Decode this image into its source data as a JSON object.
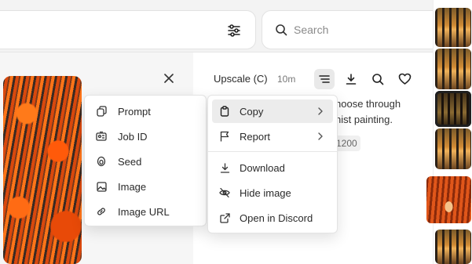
{
  "search": {
    "placeholder": "Search",
    "value": ""
  },
  "detail": {
    "title": "Upscale (C)",
    "time": "10m",
    "prompt_fragment_1": "hoose through",
    "prompt_fragment_2": "nist painting.",
    "param_fragment": "1200"
  },
  "context_menu": {
    "items": [
      {
        "label": "Copy",
        "icon": "clipboard-icon",
        "submenu": true
      },
      {
        "label": "Report",
        "icon": "flag-icon",
        "submenu": true
      },
      {
        "label": "Download",
        "icon": "download-icon"
      },
      {
        "label": "Hide image",
        "icon": "eye-off-icon"
      },
      {
        "label": "Open in Discord",
        "icon": "external-link-icon"
      }
    ]
  },
  "copy_submenu": {
    "items": [
      {
        "label": "Prompt",
        "icon": "copy-icon"
      },
      {
        "label": "Job ID",
        "icon": "id-card-icon"
      },
      {
        "label": "Seed",
        "icon": "seed-icon"
      },
      {
        "label": "Image",
        "icon": "image-icon"
      },
      {
        "label": "Image URL",
        "icon": "link-icon"
      }
    ]
  },
  "colors": {
    "accent": "#1f1f1f",
    "highlight": "#ececec",
    "background": "#f3f3f3"
  }
}
